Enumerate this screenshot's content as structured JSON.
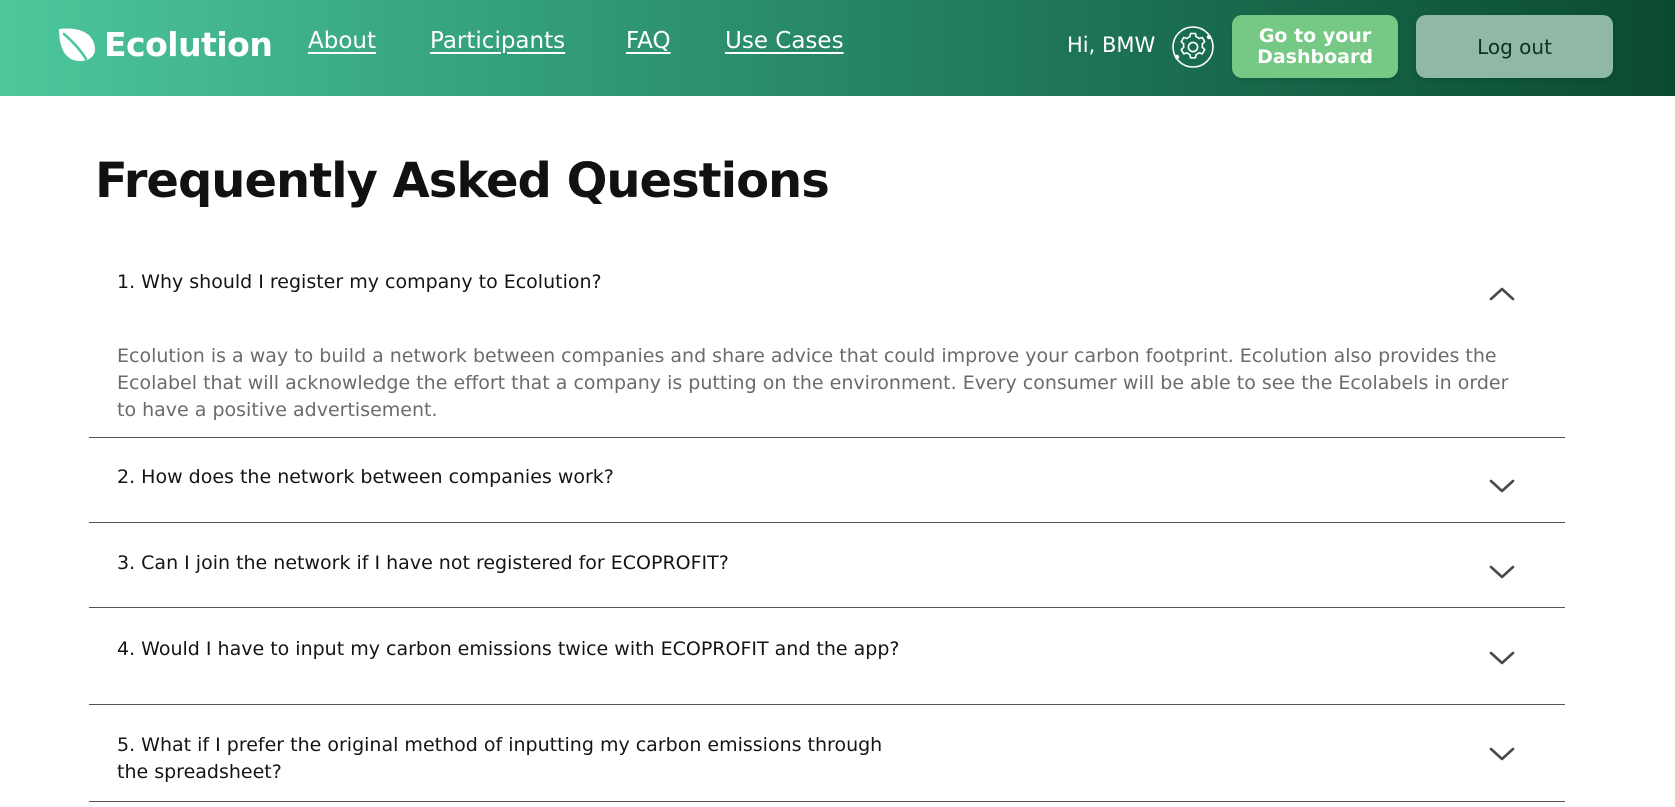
{
  "header": {
    "brand": "Ecolution",
    "nav": [
      {
        "label": "About"
      },
      {
        "label": "Participants"
      },
      {
        "label": "FAQ"
      },
      {
        "label": "Use Cases"
      }
    ],
    "greeting": "Hi, BMW",
    "dashboard_button": "Go to your Dashboard",
    "logout_button": "Log out",
    "colors": {
      "gradient_start": "#4ec79b",
      "gradient_end": "#0a4a30",
      "dashboard_button": "#76c885",
      "logout_button": "#8fb8a6"
    }
  },
  "page": {
    "title": "Frequently Asked Questions"
  },
  "faq": {
    "items": [
      {
        "question": "1. Why should I register my company to Ecolution?",
        "answer": "Ecolution is a way to build a network between companies and share advice that could improve your carbon footprint. Ecolution also provides the Ecolabel that will acknowledge the effort that a company is putting on the environment. Every consumer will be able to see the Ecolabels in order to have a positive advertisement.",
        "expanded": true,
        "chevron_icon": "chevron-up-icon"
      },
      {
        "question": "2. How does the network between companies work?",
        "expanded": false,
        "chevron_icon": "chevron-down-icon"
      },
      {
        "question": "3. Can I join the network if I have not registered for ECOPROFIT?",
        "expanded": false,
        "chevron_icon": "chevron-down-icon"
      },
      {
        "question": "4. Would I have to input my carbon emissions twice with ECOPROFIT and the app?",
        "expanded": false,
        "chevron_icon": "chevron-down-icon"
      },
      {
        "question": "5. What if I prefer the original method of inputting my carbon emissions through the spreadsheet?",
        "expanded": false,
        "chevron_icon": "chevron-down-icon"
      }
    ]
  }
}
